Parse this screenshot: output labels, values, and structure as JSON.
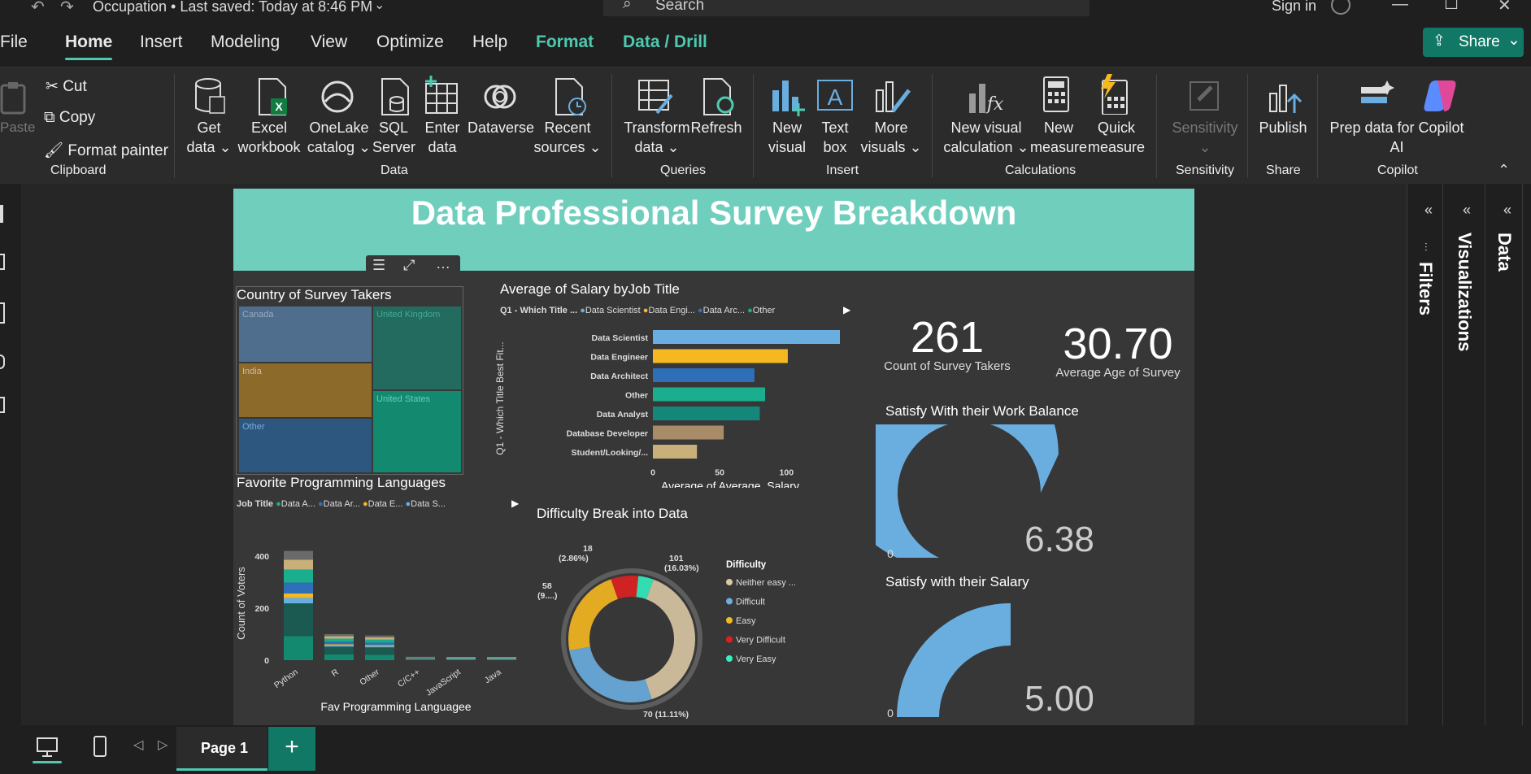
{
  "titlebar": {
    "file_title": "Occupation • Last saved: Today at 8:46 PM",
    "search_placeholder": "Search",
    "signin": "Sign in"
  },
  "menu": {
    "tabs": [
      "File",
      "Home",
      "Insert",
      "Modeling",
      "View",
      "Optimize",
      "Help",
      "Format",
      "Data / Drill"
    ],
    "share_label": "Share"
  },
  "ribbon": {
    "clipboard": {
      "paste": "Paste",
      "cut": "Cut",
      "copy": "Copy",
      "format_painter": "Format painter",
      "group": "Clipboard"
    },
    "data": {
      "get_data": [
        "Get",
        "data ⌄"
      ],
      "excel": [
        "Excel",
        "workbook"
      ],
      "onelake": [
        "OneLake",
        "catalog ⌄"
      ],
      "sql": [
        "SQL",
        "Server"
      ],
      "enter": [
        "Enter",
        "data"
      ],
      "dataverse": [
        "Dataverse",
        ""
      ],
      "recent": [
        "Recent",
        "sources ⌄"
      ],
      "group": "Data"
    },
    "queries": {
      "transform": [
        "Transform",
        "data ⌄"
      ],
      "refresh": [
        "Refresh",
        ""
      ],
      "group": "Queries"
    },
    "insert": {
      "new_visual": [
        "New",
        "visual"
      ],
      "text_box": [
        "Text",
        "box"
      ],
      "more_visuals": [
        "More",
        "visuals ⌄"
      ],
      "group": "Insert"
    },
    "calculations": {
      "new_visual_calc": [
        "New visual",
        "calculation ⌄"
      ],
      "new_measure": [
        "New",
        "measure"
      ],
      "quick_measure": [
        "Quick",
        "measure"
      ],
      "group": "Calculations"
    },
    "sensitivity": {
      "label": [
        "Sensitivity",
        "⌄"
      ],
      "group": "Sensitivity"
    },
    "share": {
      "publish": [
        "Publish",
        ""
      ],
      "group": "Share"
    },
    "copilot": {
      "prep": [
        "Prep data for Copilot",
        "AI"
      ],
      "group": "Copilot"
    }
  },
  "report": {
    "title": "Data Professional Survey Breakdown",
    "treemap": {
      "title": "Country of Survey Takers",
      "labels": [
        "Canada",
        "United Kingdom",
        "India",
        "United States",
        "Other"
      ]
    },
    "salary_chart": {
      "title": "Average of Salary byJob Title",
      "legend_title": "Q1 - Which Title ...",
      "legend": [
        "Data Scientist",
        "Data Engi...",
        "Data Arc...",
        "Other"
      ],
      "ylabel": "Q1 - Which Title Best Fit...",
      "xlabel": "Average of Average_Salary"
    },
    "kpi": {
      "count_value": "261",
      "count_label": "Count of Survey Takers",
      "age_value": "30.70",
      "age_label": "Average Age of Survey"
    },
    "gauge1": {
      "title": "Satisfy With their Work Balance",
      "value_label": "6.38",
      "min": "0",
      "max": "10"
    },
    "gauge2": {
      "title": "Satisfy with their Salary",
      "value_label": "5.00",
      "min": "0",
      "max": "10"
    },
    "lang_chart": {
      "title": "Favorite Programming Languages",
      "legend_title": "Job Title",
      "legend": [
        "Data A...",
        "Data Ar...",
        "Data E...",
        "Data S..."
      ],
      "ylabel": "Count of Voters",
      "xlabel": "Fav Programming Languagee"
    },
    "donut": {
      "title": "Difficulty Break into Data",
      "legend_title": "Difficulty",
      "legend": [
        "Neither easy ...",
        "Difficult",
        "Easy",
        "Very Difficult",
        "Very Easy"
      ],
      "labels": [
        "101",
        "(16.03%)",
        "18",
        "(2.86%)",
        "58",
        "(9....)",
        "70 (11.11%)"
      ]
    }
  },
  "panes": {
    "filters": "Filters",
    "visualizations": "Visualizations",
    "data": "Data"
  },
  "bottombar": {
    "page_tab": "Page 1",
    "add": "+"
  },
  "colors": {
    "accent": "#4ec9b0",
    "header_band": "#70cebd",
    "gauge": "#6aaee0"
  },
  "chart_data": [
    {
      "type": "bar",
      "title": "Average of Salary byJob Title",
      "orientation": "horizontal",
      "categories": [
        "Data Scientist",
        "Data Engineer",
        "Data Architect",
        "Other",
        "Data Analyst",
        "Database Developer",
        "Student/Looking/..."
      ],
      "values": [
        140,
        101,
        76,
        84,
        80,
        53,
        33
      ],
      "colors": [
        "#6aaee0",
        "#f5b820",
        "#2f6fb8",
        "#1aae8e",
        "#13877a",
        "#a88c6a",
        "#c9b07a"
      ],
      "xlabel": "Average of Average_Salary",
      "ylabel": "Q1 - Which Title Best Fit...",
      "xticks": [
        0,
        50,
        100
      ],
      "xlim": [
        0,
        140
      ]
    },
    {
      "type": "bar",
      "title": "Favorite Programming Languages",
      "stacked": true,
      "categories": [
        "Python",
        "R",
        "Other",
        "C/C++",
        "JavaScript",
        "Java"
      ],
      "values": [
        420,
        100,
        95,
        7,
        5,
        3
      ],
      "yticks": [
        0,
        200,
        400
      ],
      "ylim": [
        0,
        450
      ],
      "xlabel": "Fav Programming Languagee",
      "ylabel": "Count of Voters"
    },
    {
      "type": "pie",
      "title": "Difficulty Break into Data",
      "donut": true,
      "categories": [
        "Neither easy ...",
        "Difficult",
        "Easy",
        "Very Difficult",
        "Very Easy"
      ],
      "values": [
        101,
        70,
        58,
        18,
        10
      ],
      "colors": [
        "#d9c8a3",
        "#6aaee0",
        "#f5b820",
        "#e02020",
        "#33f0c0"
      ]
    },
    {
      "type": "gauge",
      "title": "Satisfy With their Work Balance",
      "value": 6.38,
      "min": 0,
      "max": 10
    },
    {
      "type": "gauge",
      "title": "Satisfy with their Salary",
      "value": 5.0,
      "min": 0,
      "max": 10
    }
  ]
}
